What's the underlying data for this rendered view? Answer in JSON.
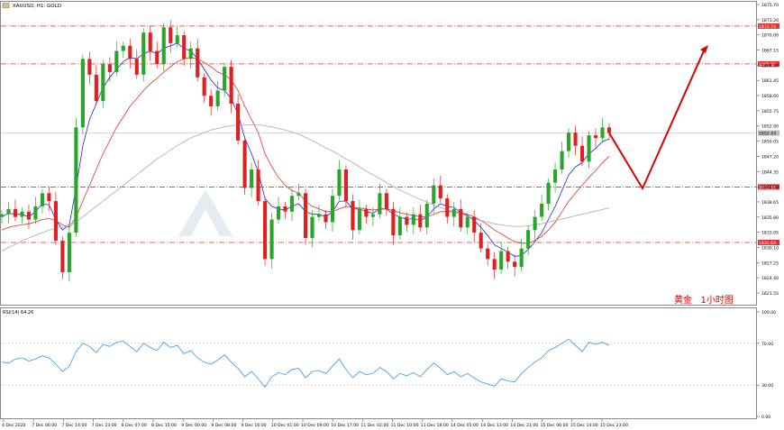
{
  "window_title": "XAUUSD, H1: GOLD",
  "chart_data": [
    {
      "type": "candlestick",
      "symbol": "XAUUSD",
      "timeframe": "H1",
      "title": "XAUUSD, H1: GOLD",
      "ylim": [
        1820.0,
        1877.0
      ],
      "y_ticks": [
        "1875.70",
        "1873.20",
        "1870.00",
        "1867.15",
        "1864.30",
        "1861.45",
        "1858.60",
        "1855.75",
        "1852.90",
        "1850.05",
        "1847.20",
        "1844.35",
        "1841.50",
        "1838.65",
        "1835.80",
        "1833.05",
        "1830.10",
        "1827.25",
        "1824.40",
        "1821.55"
      ],
      "x_ticks": [
        "4 Dec 2020",
        "7 Dec 06:00",
        "7 Dec 14:00",
        "7 Dec 23:00",
        "8 Dec 07:00",
        "8 Dec 15:00",
        "9 Dec 00:00",
        "9 Dec 08:00",
        "9 Dec 16:00",
        "10 Dec 01:00",
        "10 Dec 09:00",
        "10 Dec 17:00",
        "11 Dec 02:00",
        "11 Dec 10:00",
        "11 Dec 18:00",
        "14 Dec 05:00",
        "14 Dec 13:00",
        "14 Dec 21:00",
        "15 Dec 06:00",
        "15 Dec 14:00",
        "15 Dec 23:00"
      ],
      "horizontal_levels": [
        {
          "value": 1872.74,
          "label": "1872.74",
          "color": "#e23030"
        },
        {
          "value": 1865.55,
          "label": "1865.55",
          "color": "#e23030"
        },
        {
          "value": 1842.18,
          "label": "1842.18",
          "color": "#e23030"
        },
        {
          "value": 1831.64,
          "label": "1831.64",
          "color": "#e23030"
        }
      ],
      "current_price": {
        "value": 1852.43,
        "label": "1852.43"
      },
      "close_path": [
        1837,
        1838,
        1836.5,
        1837.5,
        1836,
        1838.5,
        1841,
        1839.5,
        1832,
        1826,
        1833.5,
        1853.5,
        1866.5,
        1863.5,
        1858.5,
        1865.5,
        1864,
        1868,
        1869,
        1866.5,
        1863.5,
        1871.5,
        1868,
        1865.5,
        1872.5,
        1869.5,
        1871,
        1866.5,
        1868.5,
        1863,
        1859.5,
        1857.5,
        1860.5,
        1865,
        1858,
        1851,
        1842,
        1845.5,
        1839.5,
        1828.5,
        1836,
        1838.5,
        1837.5,
        1840.5,
        1841,
        1832.5,
        1836.5,
        1837,
        1835.5,
        1840.5,
        1845.5,
        1839.5,
        1834,
        1838,
        1836.5,
        1837,
        1841,
        1838,
        1833,
        1836.5,
        1835,
        1837,
        1834.5,
        1839,
        1842.5,
        1840,
        1836.5,
        1838,
        1834.5,
        1836.5,
        1833.5,
        1830.5,
        1828.5,
        1826.5,
        1830,
        1828,
        1827,
        1830.5,
        1834,
        1836.5,
        1839,
        1843,
        1845.5,
        1849,
        1852.5,
        1850,
        1847,
        1852,
        1851.5,
        1853.5,
        1852.43
      ],
      "moving_averages": [
        {
          "color": "#2222dd",
          "period_label": "fast MA",
          "values": [
            1836.5,
            1837.2,
            1837,
            1837,
            1836.5,
            1837.5,
            1839,
            1838.8,
            1836,
            1834,
            1835,
            1842,
            1850,
            1855,
            1858,
            1861,
            1863,
            1864.5,
            1866,
            1866.8,
            1866.5,
            1867.5,
            1868,
            1867.5,
            1868.5,
            1869,
            1869.5,
            1868.5,
            1868,
            1866.5,
            1864.5,
            1862.5,
            1861,
            1860.5,
            1859,
            1856,
            1851.5,
            1848.5,
            1845,
            1840,
            1838.5,
            1838,
            1837.8,
            1838.5,
            1839,
            1837.5,
            1837,
            1837,
            1836.5,
            1837.5,
            1839.5,
            1839.5,
            1838,
            1838,
            1837.5,
            1837.2,
            1838,
            1838,
            1837,
            1836.5,
            1836,
            1836.2,
            1835.8,
            1836.5,
            1838,
            1839,
            1838.5,
            1838.3,
            1837.3,
            1836.8,
            1835.8,
            1834.5,
            1833,
            1831.2,
            1830.5,
            1829.8,
            1829,
            1829.2,
            1830.3,
            1831.8,
            1833.5,
            1836,
            1838.5,
            1841.5,
            1844.5,
            1846,
            1846.8,
            1848.5,
            1849.5,
            1850.8,
            1851.3
          ]
        },
        {
          "color": "#e23030",
          "period_label": "mid MA",
          "values": [
            1834,
            1834.5,
            1834.8,
            1835,
            1835.2,
            1835.5,
            1836,
            1836.2,
            1835.8,
            1835,
            1834.5,
            1836.5,
            1839.5,
            1842.5,
            1845.5,
            1848.5,
            1851,
            1853.5,
            1855.5,
            1857.5,
            1859,
            1860.5,
            1861.8,
            1862.8,
            1864,
            1865,
            1866,
            1866.5,
            1866.8,
            1866.5,
            1865.8,
            1865,
            1864,
            1863.5,
            1862.5,
            1860.5,
            1857.5,
            1855,
            1852.5,
            1848.5,
            1846,
            1844,
            1842.5,
            1841.5,
            1841,
            1839.5,
            1838.5,
            1838,
            1837.5,
            1837.5,
            1838,
            1838.5,
            1838.3,
            1838.2,
            1838,
            1837.8,
            1838,
            1838,
            1837.7,
            1837.3,
            1837,
            1836.8,
            1836.5,
            1836.5,
            1837,
            1837.5,
            1837.5,
            1837.5,
            1837.3,
            1837,
            1836.5,
            1835.8,
            1835,
            1834,
            1833.3,
            1832.5,
            1831.8,
            1831.5,
            1831.5,
            1832,
            1832.8,
            1834,
            1835.5,
            1837.5,
            1839.5,
            1841,
            1842.5,
            1844,
            1845.3,
            1846.8,
            1848
          ]
        },
        {
          "color": "#aaaaaa",
          "period_label": "slow MA",
          "values": [
            1830,
            1830.7,
            1831.3,
            1832,
            1832.5,
            1833,
            1833.5,
            1834,
            1834.3,
            1834.5,
            1834.8,
            1835.5,
            1836.5,
            1837.5,
            1838.5,
            1839.5,
            1840.5,
            1841.5,
            1842.5,
            1843.5,
            1844.5,
            1845.5,
            1846.5,
            1847.5,
            1848.3,
            1849.2,
            1850,
            1850.8,
            1851.5,
            1852,
            1852.5,
            1853,
            1853.3,
            1853.6,
            1853.8,
            1854,
            1854,
            1854,
            1854,
            1853.8,
            1853.6,
            1853.3,
            1853,
            1852.6,
            1852.2,
            1851.6,
            1851,
            1850.3,
            1849.6,
            1849,
            1848.3,
            1847.5,
            1846.8,
            1846,
            1845.2,
            1844.5,
            1843.8,
            1843,
            1842.3,
            1841.6,
            1841,
            1840.4,
            1839.8,
            1839.3,
            1838.8,
            1838.3,
            1837.8,
            1837.4,
            1837,
            1836.6,
            1836.2,
            1835.8,
            1835.5,
            1835.2,
            1835,
            1834.8,
            1834.7,
            1834.7,
            1834.8,
            1835,
            1835.2,
            1835.5,
            1835.8,
            1836.1,
            1836.4,
            1836.7,
            1837,
            1837.3,
            1837.6,
            1837.9,
            1838.2
          ]
        }
      ],
      "forecast_arrow_color": "#dd0000",
      "annotation": "黄金   1小时图"
    },
    {
      "type": "line",
      "title": "RSI(14) 64.26",
      "ylim": [
        0,
        100
      ],
      "y_ticks": [
        "100.00",
        "70.00",
        "30.00",
        "0.00"
      ],
      "levels": [
        70,
        30
      ],
      "series": [
        {
          "color": "#3399dd",
          "values": [
            52,
            51,
            55,
            56,
            53,
            55,
            58,
            56,
            50,
            43,
            48,
            62,
            70,
            67,
            61,
            69,
            67,
            71,
            72,
            67,
            62,
            70,
            66,
            63,
            71,
            66,
            68,
            60,
            63,
            56,
            52,
            50,
            54,
            59,
            52,
            46,
            38,
            43,
            36,
            28,
            38,
            42,
            40,
            45,
            46,
            37,
            43,
            44,
            41,
            48,
            55,
            45,
            37,
            43,
            40,
            41,
            47,
            43,
            36,
            41,
            39,
            42,
            38,
            45,
            51,
            46,
            40,
            43,
            38,
            41,
            37,
            33,
            31,
            29,
            36,
            34,
            33,
            41,
            47,
            52,
            56,
            63,
            66,
            70,
            74,
            68,
            62,
            71,
            69,
            71,
            68
          ]
        }
      ]
    }
  ]
}
